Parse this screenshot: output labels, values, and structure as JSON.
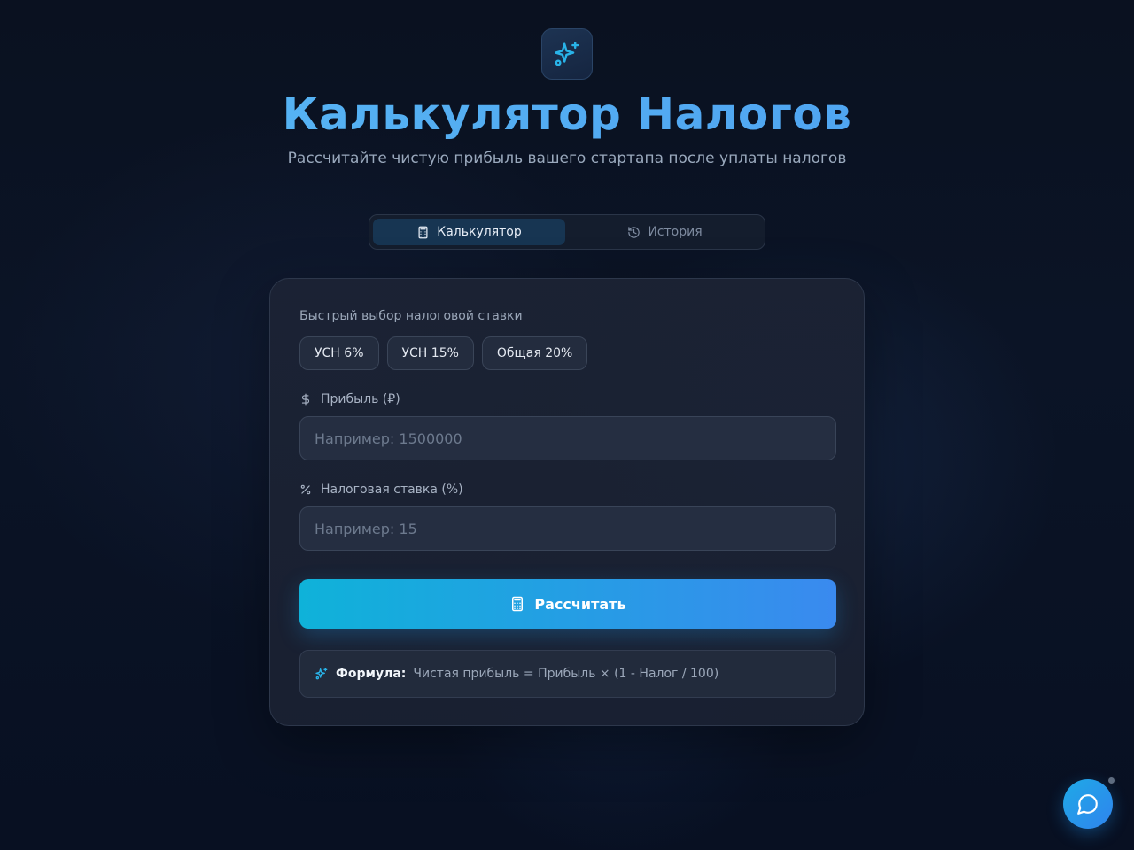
{
  "header": {
    "logo_icon": "sparkles-icon",
    "title": "Калькулятор Налогов",
    "subtitle": "Рассчитайте чистую прибыль вашего стартапа после уплаты налогов"
  },
  "tabs": [
    {
      "label": "Калькулятор",
      "icon": "calculator-icon",
      "active": true
    },
    {
      "label": "История",
      "icon": "history-icon",
      "active": false
    }
  ],
  "form": {
    "quick_label": "Быстрый выбор налоговой ставки",
    "presets": [
      "УСН 6%",
      "УСН 15%",
      "Общая 20%"
    ],
    "profit": {
      "label": "Прибыль (₽)",
      "icon": "dollar-icon",
      "value": "",
      "placeholder": "Например: 1500000"
    },
    "rate": {
      "label": "Налоговая ставка (%)",
      "icon": "percent-icon",
      "value": "",
      "placeholder": "Например: 15"
    },
    "submit_label": "Рассчитать",
    "formula_label": "Формула:",
    "formula_text": "Чистая прибыль = Прибыль × (1 - Налог / 100)"
  },
  "colors": {
    "accent": "#5aaef0",
    "button_start": "#0fb2d9",
    "button_end": "#3a8aef",
    "background": "#0b1426"
  }
}
